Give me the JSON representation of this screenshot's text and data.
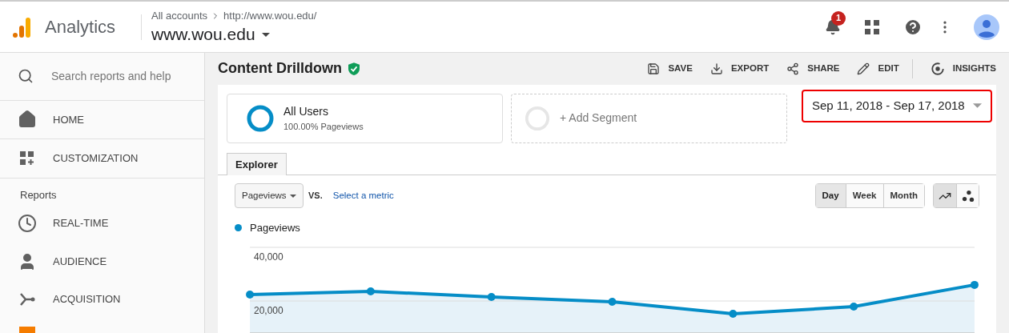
{
  "header": {
    "app_name": "Analytics",
    "breadcrumb": [
      "All accounts",
      "http://www.wou.edu/"
    ],
    "property": "www.wou.edu",
    "notification_count": "1"
  },
  "sidebar": {
    "search_placeholder": "Search reports and help",
    "items": [
      {
        "kind": "item",
        "label": "HOME"
      },
      {
        "kind": "item",
        "label": "CUSTOMIZATION"
      },
      {
        "kind": "heading",
        "label": "Reports"
      },
      {
        "kind": "item",
        "label": "REAL-TIME"
      },
      {
        "kind": "item",
        "label": "AUDIENCE"
      },
      {
        "kind": "item",
        "label": "ACQUISITION"
      }
    ]
  },
  "page": {
    "title": "Content Drilldown",
    "actions": [
      {
        "label": "SAVE"
      },
      {
        "label": "EXPORT"
      },
      {
        "label": "SHARE"
      },
      {
        "label": "EDIT"
      },
      {
        "label": "INSIGHTS"
      }
    ],
    "segments": [
      {
        "kind": "active",
        "name": "All Users",
        "detail": "100.00% Pageviews"
      },
      {
        "kind": "add",
        "name": "+ Add Segment"
      }
    ],
    "date_range": "Sep 11, 2018 - Sep 17, 2018",
    "tabs": [
      {
        "label": "Explorer",
        "selected": true
      }
    ],
    "metric": "Pageviews",
    "vs": "VS.",
    "select_metric": "Select a metric",
    "granularity": [
      {
        "label": "Day",
        "selected": true
      },
      {
        "label": "Week",
        "selected": false
      },
      {
        "label": "Month",
        "selected": false
      }
    ],
    "chart_types": [
      {
        "kind": "line",
        "selected": true
      },
      {
        "kind": "motion",
        "selected": false
      }
    ],
    "chart_data": {
      "type": "area",
      "ylim": [
        8000,
        40000
      ],
      "yticks": [
        {
          "value": 20000,
          "label": "20,000"
        },
        {
          "value": 40000,
          "label": "40,000"
        }
      ],
      "series": [
        {
          "name": "Pageviews",
          "color": "#058dc7",
          "values": [
            22400,
            23600,
            21500,
            19700,
            15200,
            17900,
            26000
          ]
        }
      ]
    }
  }
}
